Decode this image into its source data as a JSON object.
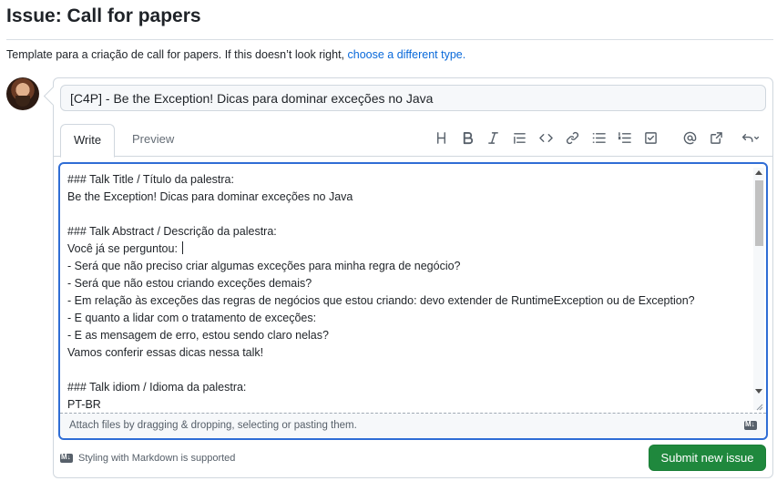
{
  "header": {
    "title": "Issue: Call for papers"
  },
  "template_note": {
    "text": "Template para a criação de call for papers. If this doesn’t look right, ",
    "link": "choose a different type."
  },
  "issue": {
    "title_value": "[C4P] - Be the Exception! Dicas para dominar exceções no Java",
    "tabs": {
      "write": "Write",
      "preview": "Preview"
    },
    "toolbar": [
      "heading",
      "bold",
      "italic",
      "quote",
      "code",
      "link",
      "bulleted-list",
      "numbered-list",
      "task-list",
      "mention",
      "reference",
      "undo"
    ],
    "body_lines": [
      "### Talk Title / Título da palestra:",
      "Be the Exception! Dicas para dominar exceções no Java",
      "",
      "### Talk Abstract / Descrição da palestra:",
      "Você já se perguntou: ",
      "- Será que não preciso criar algumas exceções para minha regra de negócio?",
      "- Será que não estou criando exceções demais?",
      "- Em relação às exceções das regras de negócios que estou criando: devo extender de RuntimeException ou de Exception?",
      "- E quanto a lidar com o tratamento de exceções:",
      "- E as mensagem de erro, estou sendo claro nelas?",
      "Vamos conferir essas dicas nessa talk!",
      "",
      "### Talk idiom / Idioma da palestra:",
      "PT-BR"
    ],
    "attach_hint": "Attach files by dragging & dropping, selecting or pasting them.",
    "markdown_note": "Styling with Markdown is supported",
    "submit_label": "Submit new issue"
  },
  "colors": {
    "accent": "#2f6dd5",
    "link": "#0969da",
    "submit": "#1f883d"
  }
}
